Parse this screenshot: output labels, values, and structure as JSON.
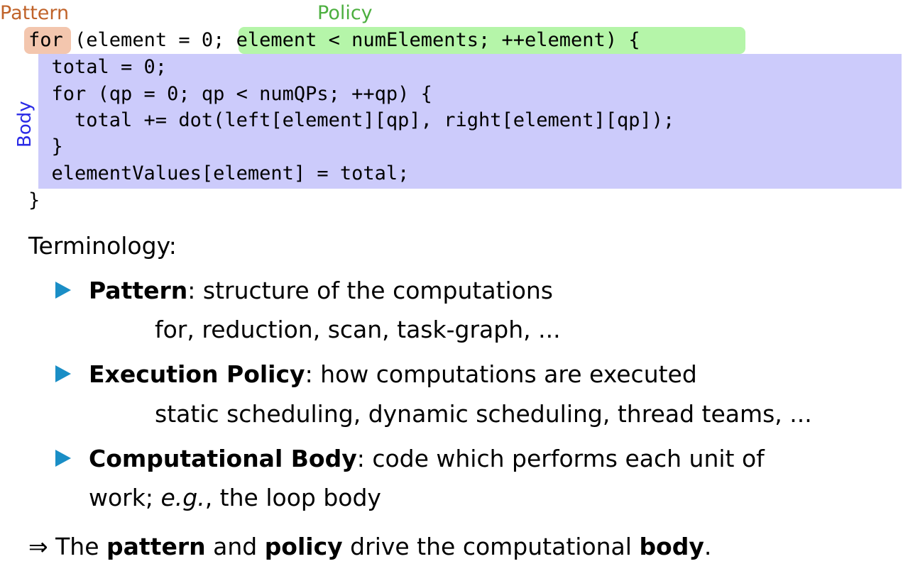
{
  "labels": {
    "pattern": "Pattern",
    "policy": "Policy",
    "body": "Body"
  },
  "colors": {
    "pattern_label": "#c0632a",
    "policy_label": "#4caf3f",
    "body_label": "#2a2ae6",
    "pattern_highlight": "#f3c6ae",
    "policy_highlight": "#b5f5a9",
    "body_highlight": "#cccbfb",
    "bullet": "#1a8ec6"
  },
  "code": {
    "for_keyword": "for",
    "open_paren": " (element = ",
    "policy_text": "0; element < numElements; ++element",
    "close_paren": ") {",
    "body_lines": [
      "  total = 0;",
      "  for (qp = 0; qp < numQPs; ++qp) {",
      "    total += dot(left[element][qp], right[element][qp]);",
      "  }",
      "  elementValues[element] = total;"
    ],
    "closing_brace": "}"
  },
  "terminology": {
    "heading": "Terminology:",
    "items": [
      {
        "term": "Pattern",
        "definition": ": structure of the computations",
        "examples": "for, reduction, scan, task-graph, ..."
      },
      {
        "term": "Execution Policy",
        "definition": ": how computations are executed",
        "examples": "static scheduling, dynamic scheduling, thread teams, ..."
      },
      {
        "term": "Computational Body",
        "definition": ": code which performs each unit of",
        "line2_pre": "work; ",
        "line2_italic": "e.g.",
        "line2_post": ", the loop body"
      }
    ]
  },
  "conclusion": {
    "arrow": "⇒",
    "pre": " The ",
    "w1": "pattern",
    "mid1": " and ",
    "w2": "policy",
    "mid2": " drive the computational ",
    "w3": "body",
    "end": "."
  }
}
